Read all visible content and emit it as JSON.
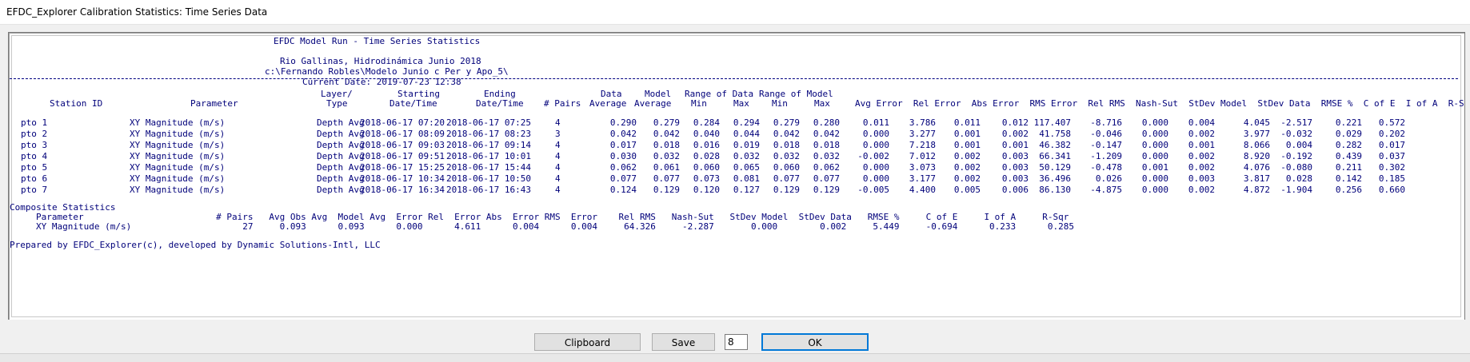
{
  "window": {
    "title": "EFDC_Explorer Calibration Statistics: Time Series Data"
  },
  "report": {
    "heading": "EFDC Model Run - Time Series Statistics",
    "project": "Rio Gallinas, Hidrodinámica Junio 2018",
    "path": "c:\\Fernando Robles\\Modelo Junio c Per y Apo_5\\",
    "current_date": "Current Date: 2019-07-23 12:38",
    "columns": {
      "station_id": "Station ID",
      "parameter": "Parameter",
      "layer_type": [
        "Layer/",
        "Type"
      ],
      "starting": [
        "Starting",
        "Date/Time"
      ],
      "ending": [
        "Ending",
        "Date/Time"
      ],
      "pairs": "# Pairs",
      "data_average": [
        "Data",
        "Average"
      ],
      "model_average": [
        "Model",
        "Average"
      ],
      "range_data": [
        "Range of Data",
        "Min     Max"
      ],
      "range_model": [
        "Range of Model",
        "Min     Max"
      ],
      "tail": "Avg Error  Rel Error  Abs Error  RMS Error  Rel RMS  Nash-Sut  StDev Model  StDev Data  RMSE %  C of E  I of A  R-Sqr"
    },
    "rows": [
      {
        "id": "pto 1",
        "param": "XY Magnitude (m/s)",
        "layer": "Depth Avg",
        "start": "2018-06-17 07:20",
        "end": "2018-06-17 07:25",
        "pairs": "4",
        "values": [
          "0.290",
          "0.279",
          "0.284",
          "0.294",
          "0.279",
          "0.280",
          "0.011",
          "3.786",
          "0.011",
          "0.012",
          "117.407",
          "-8.716",
          "0.000",
          "0.004",
          "4.045",
          "-2.517",
          "0.221",
          "0.572"
        ]
      },
      {
        "id": "pto 2",
        "param": "XY Magnitude (m/s)",
        "layer": "Depth Avg",
        "start": "2018-06-17 08:09",
        "end": "2018-06-17 08:23",
        "pairs": "3",
        "values": [
          "0.042",
          "0.042",
          "0.040",
          "0.044",
          "0.042",
          "0.042",
          "0.000",
          "3.277",
          "0.001",
          "0.002",
          "41.758",
          "-0.046",
          "0.000",
          "0.002",
          "3.977",
          "-0.032",
          "0.029",
          "0.202"
        ]
      },
      {
        "id": "pto 3",
        "param": "XY Magnitude (m/s)",
        "layer": "Depth Avg",
        "start": "2018-06-17 09:03",
        "end": "2018-06-17 09:14",
        "pairs": "4",
        "values": [
          "0.017",
          "0.018",
          "0.016",
          "0.019",
          "0.018",
          "0.018",
          "0.000",
          "7.218",
          "0.001",
          "0.001",
          "46.382",
          "-0.147",
          "0.000",
          "0.001",
          "8.066",
          "0.004",
          "0.282",
          "0.017"
        ]
      },
      {
        "id": "pto 4",
        "param": "XY Magnitude (m/s)",
        "layer": "Depth Avg",
        "start": "2018-06-17 09:51",
        "end": "2018-06-17 10:01",
        "pairs": "4",
        "values": [
          "0.030",
          "0.032",
          "0.028",
          "0.032",
          "0.032",
          "0.032",
          "-0.002",
          "7.012",
          "0.002",
          "0.003",
          "66.341",
          "-1.209",
          "0.000",
          "0.002",
          "8.920",
          "-0.192",
          "0.439",
          "0.037"
        ]
      },
      {
        "id": "pto 5",
        "param": "XY Magnitude (m/s)",
        "layer": "Depth Avg",
        "start": "2018-06-17 15:25",
        "end": "2018-06-17 15:44",
        "pairs": "4",
        "values": [
          "0.062",
          "0.061",
          "0.060",
          "0.065",
          "0.060",
          "0.062",
          "0.000",
          "3.073",
          "0.002",
          "0.003",
          "50.129",
          "-0.478",
          "0.001",
          "0.002",
          "4.076",
          "-0.080",
          "0.211",
          "0.302"
        ]
      },
      {
        "id": "pto 6",
        "param": "XY Magnitude (m/s)",
        "layer": "Depth Avg",
        "start": "2018-06-17 10:34",
        "end": "2018-06-17 10:50",
        "pairs": "4",
        "values": [
          "0.077",
          "0.077",
          "0.073",
          "0.081",
          "0.077",
          "0.077",
          "0.000",
          "3.177",
          "0.002",
          "0.003",
          "36.496",
          "0.026",
          "0.000",
          "0.003",
          "3.817",
          "0.028",
          "0.142",
          "0.185"
        ]
      },
      {
        "id": "pto 7",
        "param": "XY Magnitude (m/s)",
        "layer": "Depth Avg",
        "start": "2018-06-17 16:34",
        "end": "2018-06-17 16:43",
        "pairs": "4",
        "values": [
          "0.124",
          "0.129",
          "0.120",
          "0.127",
          "0.129",
          "0.129",
          "-0.005",
          "4.400",
          "0.005",
          "0.006",
          "86.130",
          "-4.875",
          "0.000",
          "0.002",
          "4.872",
          "-1.904",
          "0.256",
          "0.660"
        ]
      }
    ],
    "composite": {
      "title": "Composite Statistics",
      "header": "Parameter                         # Pairs   Avg Obs Avg  Model Avg  Error Rel  Error Abs  Error RMS  Error    Rel RMS   Nash-Sut   StDev Model  StDev Data   RMSE %     C of E     I of A     R-Sqr",
      "row": "XY Magnitude (m/s)                     27     0.093      0.093      0.000      4.611      0.004      0.004     64.326     -2.287       0.000        0.002     5.449     -0.694      0.233      0.285"
    },
    "footer": "Prepared by EFDC_Explorer(c), developed by Dynamic Solutions-Intl, LLC"
  },
  "buttons": {
    "clipboard": "Clipboard",
    "save": "Save",
    "ok": "OK",
    "digits_value": "8"
  }
}
